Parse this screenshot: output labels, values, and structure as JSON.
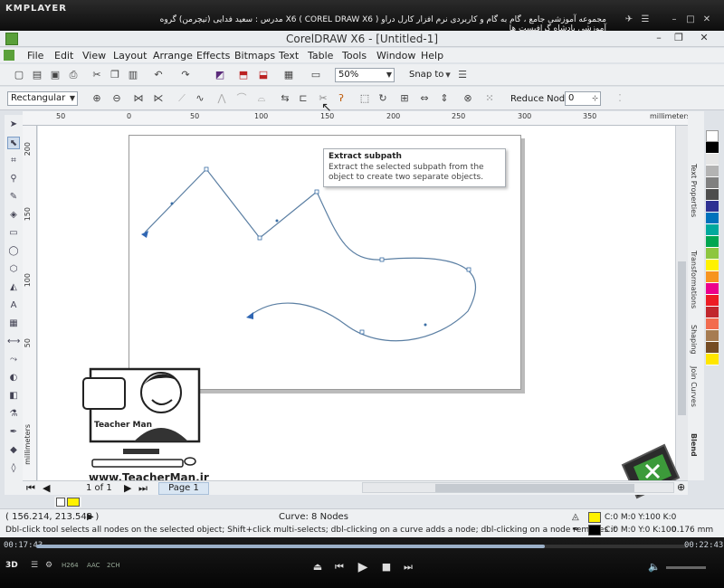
{
  "player": {
    "logo": "KMPLAYER",
    "title": "مجموعه آموزشی جامع ، گام به گام و کاربردی نرم افزار کارل دراو  X6 ( COREL DRAW X6 )   مدرس : سعید فدایی (تیچرمن) گروه آموزشی پادشاه گرافیست ها",
    "elapsed": "00:17:43",
    "total": "00:22:43",
    "progress": 0.78,
    "badges": [
      "3D",
      "H264",
      "AAC",
      "2CH"
    ]
  },
  "window": {
    "title": "CorelDRAW X6 - [Untitled-1]"
  },
  "menu": [
    "File",
    "Edit",
    "View",
    "Layout",
    "Arrange",
    "Effects",
    "Bitmaps",
    "Text",
    "Table",
    "Tools",
    "Window",
    "Help"
  ],
  "standard_toolbar": {
    "zoom": "50%",
    "snap_to": "Snap to"
  },
  "property_bar": {
    "selection_mode": "Rectangular",
    "reduce_nodes_label": "Reduce Nodes",
    "reduce_nodes_value": "0"
  },
  "ruler": {
    "unit": "millimeters",
    "h_ticks": [
      "50",
      "0",
      "50",
      "100",
      "150",
      "200",
      "250",
      "300",
      "350"
    ],
    "v_ticks": [
      "200",
      "150",
      "100",
      "50"
    ]
  },
  "tooltip": {
    "title": "Extract subpath",
    "body": "Extract the selected subpath from the object to create two separate objects."
  },
  "dockers": [
    "Text Properties",
    "Transformations",
    "Shaping",
    "Join Curves",
    "Blend"
  ],
  "palette": [
    "#ffffff",
    "#000000",
    "#e5e5e5",
    "#b3b3b3",
    "#808080",
    "#4d4d4d",
    "#2e3192",
    "#0072bc",
    "#00a99d",
    "#00a651",
    "#8dc63f",
    "#fff200",
    "#f7941d",
    "#ec008c",
    "#ed1c24",
    "#c1272d",
    "#f26c4f",
    "#a67c52",
    "#754c24",
    "#ffe600"
  ],
  "page_nav": {
    "counter": "1 of 1",
    "tab": "Page 1"
  },
  "status": {
    "coords": "( 156.214, 213.542 )",
    "object": "Curve: 8 Nodes",
    "hint": "Dbl-click tool selects all nodes on the selected object; Shift+click multi-selects; dbl-clicking on a curve adds a node; dbl-clicking on a node removes it",
    "fill": "C:0 M:0 Y:100 K:0",
    "outline": "C:0 M:0 Y:0 K:100",
    "outline_width": "0.176 mm",
    "fill_color": "#fff200",
    "outline_color": "#000000"
  },
  "watermark": {
    "url": "www.TeacherMan.ir",
    "brand": "Teacher Man"
  },
  "colors": {
    "curve": "#5b7fa3",
    "node": "#3b6ea5"
  }
}
